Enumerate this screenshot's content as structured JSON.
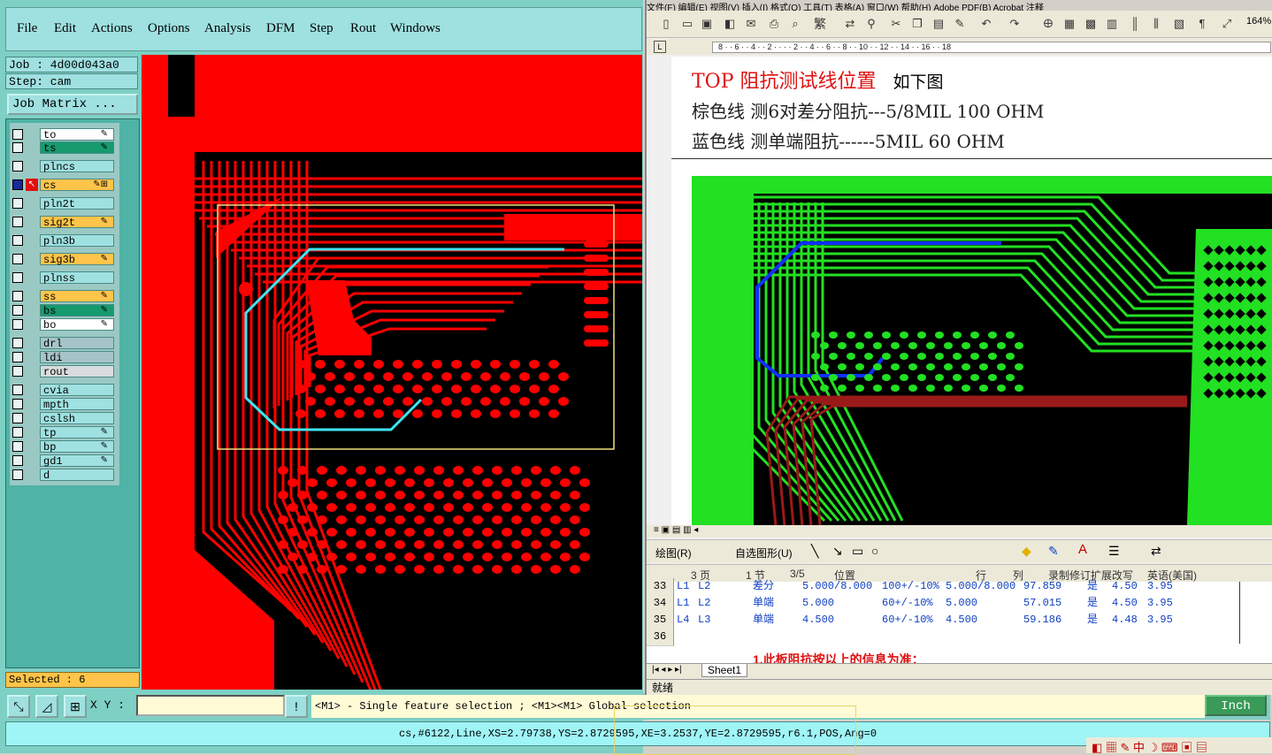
{
  "cam": {
    "menu": [
      "File",
      "Edit",
      "Actions",
      "Options",
      "Analysis",
      "DFM",
      "Step",
      "Rout",
      "Windows"
    ],
    "job_label": "Job : 4d00d043a0",
    "step_label": "Step: cam",
    "job_matrix_button": "Job Matrix ...",
    "layers": [
      {
        "name": "to",
        "color": "#ffffff",
        "mark": "✎"
      },
      {
        "name": "ts",
        "color": "#169a6e",
        "mark": "✎"
      },
      {
        "name": "plncs",
        "color": "#9fe0e0",
        "mark": ""
      },
      {
        "name": "cs",
        "color": "#ffc44a",
        "mark": "✎⊞"
      },
      {
        "name": "pln2t",
        "color": "#9fe0e0",
        "mark": ""
      },
      {
        "name": "sig2t",
        "color": "#ffc44a",
        "mark": "✎"
      },
      {
        "name": "pln3b",
        "color": "#9fe0e0",
        "mark": ""
      },
      {
        "name": "sig3b",
        "color": "#ffc44a",
        "mark": "✎"
      },
      {
        "name": "plnss",
        "color": "#9fe0e0",
        "mark": ""
      },
      {
        "name": "ss",
        "color": "#ffc44a",
        "mark": "✎"
      },
      {
        "name": "bs",
        "color": "#169a6e",
        "mark": "✎"
      },
      {
        "name": "bo",
        "color": "#ffffff",
        "mark": "✎"
      },
      {
        "name": "drl",
        "color": "#a6c4c8",
        "mark": ""
      },
      {
        "name": "ldi",
        "color": "#a6c4c8",
        "mark": ""
      },
      {
        "name": "rout",
        "color": "#d8dcdc",
        "mark": ""
      },
      {
        "name": "cvia",
        "color": "#9fe0e0",
        "mark": ""
      },
      {
        "name": "mpth",
        "color": "#9fe0e0",
        "mark": ""
      },
      {
        "name": "cslsh",
        "color": "#9fe0e0",
        "mark": ""
      },
      {
        "name": "tp",
        "color": "#9fe0e0",
        "mark": "✎"
      },
      {
        "name": "bp",
        "color": "#9fe0e0",
        "mark": "✎"
      },
      {
        "name": "gd1",
        "color": "#9fe0e0",
        "mark": "✎"
      },
      {
        "name": "d",
        "color": "#9fe0e0",
        "mark": ""
      }
    ],
    "selected_label": "Selected : 6",
    "xy_label": "X Y :",
    "hint": "<M1> - Single feature selection ; <M1><M1> Global selection",
    "unit": "Inch",
    "status": "cs,#6122,Line,XS=2.79738,YS=2.8729595,XE=3.2537,YE=2.8729595,r6.1,POS,Ang=0"
  },
  "word": {
    "menu": "文件(F)   编辑(E)   视图(V)   插入(I)   格式(O)   工具(T)   表格(A)   窗口(W)   帮助(H)   Adobe PDF(B)   Acrobat 注释",
    "zoom": "164%",
    "ruler_ticks": "8 · · 6 · · 4 · · 2 · · · · 2 · · 4 · · 6 · · 8 · · 10 · · 12 · · 14 · · 16 · · 18",
    "title_red": "TOP  阻抗测试线位置",
    "title_rest": "如下图",
    "line2": "棕色线  测6对差分阻抗---5/8MIL     100 OHM",
    "line3": "蓝色线  测单端阻抗------5MIL     60 OHM",
    "drawbar_draw": "绘图(R)",
    "drawbar_autoshape": "自选图形(U)",
    "status_items": [
      "3 页",
      "1 节",
      "3/5",
      "位置",
      "行",
      "列",
      "录制",
      "修订",
      "扩展",
      "改写",
      "英语(美国)"
    ]
  },
  "excel": {
    "rows": [
      {
        "n": "33",
        "cells": [
          "L1",
          "L2",
          "差分",
          "5.000/8.000",
          "100+/-10%",
          "5.000/8.000",
          "97.859",
          "是",
          "4.50",
          "3.95"
        ]
      },
      {
        "n": "34",
        "cells": [
          "L1",
          "L2",
          "单端",
          "5.000",
          "60+/-10%",
          "5.000",
          "57.015",
          "是",
          "4.50",
          "3.95"
        ]
      },
      {
        "n": "35",
        "cells": [
          "L4",
          "L3",
          "单端",
          "4.500",
          "60+/-10%",
          "4.500",
          "59.186",
          "是",
          "4.48",
          "3.95"
        ]
      },
      {
        "n": "36",
        "cells": []
      }
    ],
    "note": "1.此板阻抗按以上的信息为准：",
    "sheet_tab": "Sheet1",
    "ready": "就绪"
  },
  "colors": {
    "cam_bg": "#000000",
    "trace_red": "#ff0000",
    "highlight_cyan": "#3fe4f0",
    "pcb_green": "#22e022",
    "trace_blue": "#1030ff",
    "trace_maroon": "#9a1a1a"
  }
}
